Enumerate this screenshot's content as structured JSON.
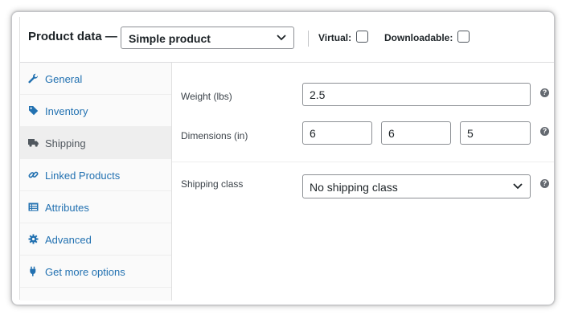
{
  "header": {
    "title": "Product data —",
    "product_type": "Simple product",
    "virtual_label": "Virtual:",
    "virtual_checked": false,
    "downloadable_label": "Downloadable:",
    "downloadable_checked": false
  },
  "tabs": [
    {
      "label": "General",
      "icon": "wrench-icon",
      "active": false
    },
    {
      "label": "Inventory",
      "icon": "tag-icon",
      "active": false
    },
    {
      "label": "Shipping",
      "icon": "truck-icon",
      "active": true
    },
    {
      "label": "Linked Products",
      "icon": "link-icon",
      "active": false
    },
    {
      "label": "Attributes",
      "icon": "list-icon",
      "active": false
    },
    {
      "label": "Advanced",
      "icon": "gear-icon",
      "active": false
    },
    {
      "label": "Get more options",
      "icon": "plugin-icon",
      "active": false
    }
  ],
  "shipping": {
    "weight_label": "Weight (lbs)",
    "weight_value": "2.5",
    "dimensions_label": "Dimensions (in)",
    "length_value": "6",
    "width_value": "6",
    "height_value": "5",
    "class_label": "Shipping class",
    "class_value": "No shipping class",
    "help_glyph": "?"
  },
  "colors": {
    "link": "#2271b1",
    "active_tab_text": "#50575e",
    "active_tab_bg": "#eeeeee",
    "border": "#8c8f94"
  }
}
